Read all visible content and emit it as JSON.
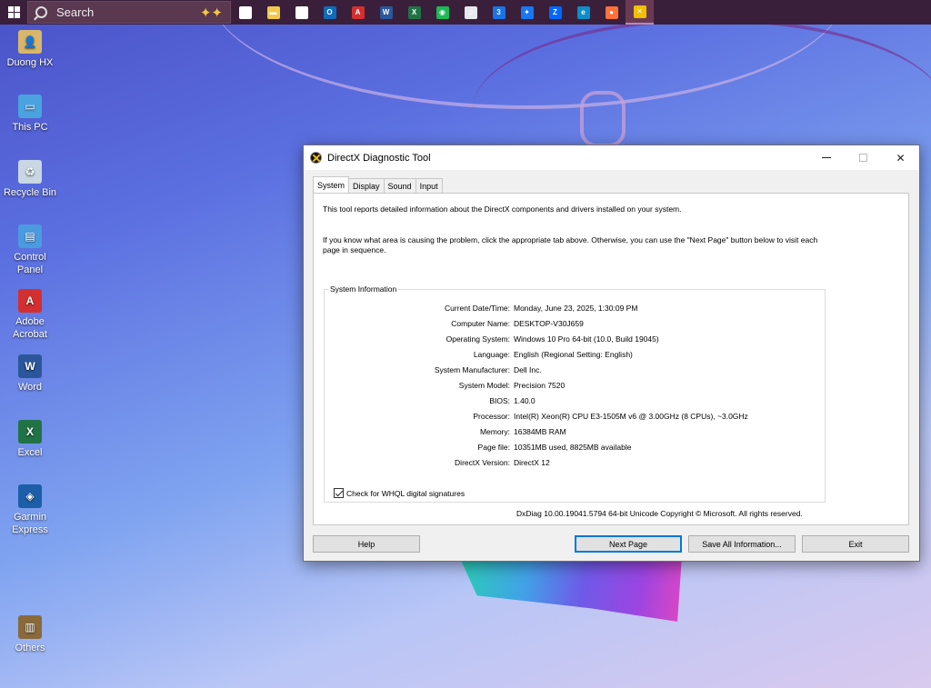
{
  "taskbar": {
    "search_placeholder": "Search",
    "icons": [
      {
        "name": "task-view-icon",
        "glyph": "⊟",
        "color": "#ffffff"
      },
      {
        "name": "file-explorer-icon",
        "glyph": "▬",
        "color": "#f2c94c"
      },
      {
        "name": "microsoft-store-icon",
        "glyph": "▦",
        "color": "#ffffff"
      },
      {
        "name": "outlook-icon",
        "glyph": "O",
        "color": "#0f6cbd"
      },
      {
        "name": "acrobat-icon",
        "glyph": "A",
        "color": "#d32f2f"
      },
      {
        "name": "word-icon",
        "glyph": "W",
        "color": "#2b579a"
      },
      {
        "name": "excel-icon",
        "glyph": "X",
        "color": "#217346"
      },
      {
        "name": "spotify-icon",
        "glyph": "◉",
        "color": "#1db954"
      },
      {
        "name": "itunes-icon",
        "glyph": "♫",
        "color": "#e8e8f0"
      },
      {
        "name": "app-3-icon",
        "glyph": "3",
        "color": "#1a73e8"
      },
      {
        "name": "messenger-icon",
        "glyph": "✦",
        "color": "#1877f2"
      },
      {
        "name": "zalo-icon",
        "glyph": "Z",
        "color": "#0068ff"
      },
      {
        "name": "edge-icon",
        "glyph": "e",
        "color": "#0c8ec8"
      },
      {
        "name": "firefox-icon",
        "glyph": "●",
        "color": "#ff7139"
      },
      {
        "name": "directx-icon",
        "glyph": "✕",
        "color": "#f0c000"
      }
    ]
  },
  "desktop_icons": [
    {
      "name": "desktop-icon-duong-hx",
      "label": "Duong HX",
      "color": "#d9b76a",
      "glyph": "👤"
    },
    {
      "name": "desktop-icon-this-pc",
      "label": "This PC",
      "color": "#4aa3df",
      "glyph": "▭"
    },
    {
      "name": "desktop-icon-recycle-bin",
      "label": "Recycle Bin",
      "color": "#c9d6e3",
      "glyph": "♻"
    },
    {
      "name": "desktop-icon-control-panel",
      "label": "Control Panel",
      "color": "#4a9be0",
      "glyph": "▤"
    },
    {
      "name": "desktop-icon-adobe-acrobat",
      "label": "Adobe Acrobat",
      "color": "#d32f2f",
      "glyph": "A"
    },
    {
      "name": "desktop-icon-word",
      "label": "Word",
      "color": "#2b579a",
      "glyph": "W"
    },
    {
      "name": "desktop-icon-excel",
      "label": "Excel",
      "color": "#217346",
      "glyph": "X"
    },
    {
      "name": "desktop-icon-garmin-express",
      "label": "Garmin Express",
      "color": "#1c5ea8",
      "glyph": "◈"
    },
    {
      "name": "desktop-icon-others",
      "label": "Others",
      "color": "#8a6a3a",
      "glyph": "▥"
    }
  ],
  "dialog": {
    "title": "DirectX Diagnostic Tool",
    "tabs": [
      "System",
      "Display",
      "Sound",
      "Input"
    ],
    "intro1": "This tool reports detailed information about the DirectX components and drivers installed on your system.",
    "intro2": "If you know what area is causing the problem, click the appropriate tab above.  Otherwise, you can use the \"Next Page\" button below to visit each page in sequence.",
    "group_title": "System Information",
    "info": [
      {
        "key": "Current Date/Time:",
        "value": "Monday, June 23, 2025, 1:30:09 PM"
      },
      {
        "key": "Computer Name:",
        "value": "DESKTOP-V30J659"
      },
      {
        "key": "Operating System:",
        "value": "Windows 10 Pro 64-bit (10.0, Build 19045)"
      },
      {
        "key": "Language:",
        "value": "English (Regional Setting: English)"
      },
      {
        "key": "System Manufacturer:",
        "value": "Dell Inc."
      },
      {
        "key": "System Model:",
        "value": "Precision 7520"
      },
      {
        "key": "BIOS:",
        "value": "1.40.0"
      },
      {
        "key": "Processor:",
        "value": "Intel(R) Xeon(R) CPU E3-1505M v6 @ 3.00GHz (8 CPUs), ~3.0GHz"
      },
      {
        "key": "Memory:",
        "value": "16384MB RAM"
      },
      {
        "key": "Page file:",
        "value": "10351MB used, 8825MB available"
      },
      {
        "key": "DirectX Version:",
        "value": "DirectX 12"
      }
    ],
    "whql_label": "Check for WHQL digital signatures",
    "whql_checked": true,
    "footer": "DxDiag 10.00.19041.5794 64-bit Unicode  Copyright © Microsoft. All rights reserved.",
    "buttons": {
      "help": "Help",
      "next_page": "Next Page",
      "save_all": "Save All Information...",
      "exit": "Exit"
    }
  }
}
